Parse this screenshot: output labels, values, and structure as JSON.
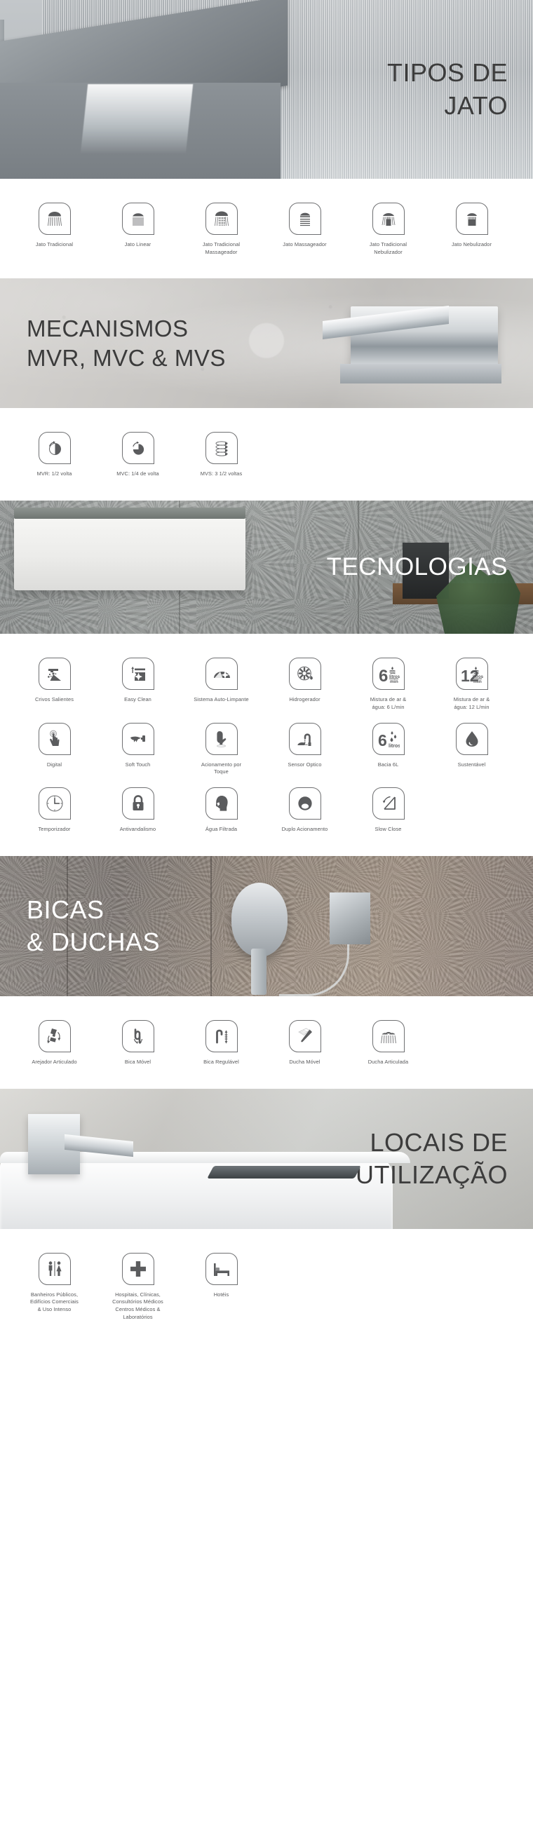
{
  "sections": [
    {
      "id": "tipos-de-jato",
      "hero": {
        "title": "TIPOS DE\nJATO",
        "align": "right",
        "text_color": "#3c3c3c"
      },
      "items": [
        {
          "icon": "jato-tradicional-icon",
          "label": "Jato Tradicional"
        },
        {
          "icon": "jato-linear-icon",
          "label": "Jato Linear"
        },
        {
          "icon": "jato-tradicional-massageador-icon",
          "label": "Jato Tradicional\nMassageador"
        },
        {
          "icon": "jato-massageador-icon",
          "label": "Jato Massageador"
        },
        {
          "icon": "jato-tradicional-nebulizador-icon",
          "label": "Jato Tradicional\nNebulizador"
        },
        {
          "icon": "jato-nebulizador-icon",
          "label": "Jato Nebulizador"
        }
      ]
    },
    {
      "id": "mecanismos",
      "hero": {
        "title": "MECANISMOS\nMVR, MVC & MVS",
        "align": "left",
        "text_color": "#3b3b3b"
      },
      "items": [
        {
          "icon": "meia-volta-icon",
          "label": "MVR: 1/2 volta"
        },
        {
          "icon": "quarto-de-volta-icon",
          "label": "MVC: 1/4 de volta"
        },
        {
          "icon": "tres-voltas-e-meia-icon",
          "label": "MVS: 3 1/2 voltas"
        }
      ]
    },
    {
      "id": "tecnologias",
      "hero": {
        "title": "TECNOLOGIAS",
        "align": "right",
        "text_color": "#ffffff"
      },
      "items": [
        {
          "icon": "crivos-salientes-icon",
          "label": "Crivos Salientes"
        },
        {
          "icon": "easy-clean-icon",
          "label": "Easy Clean"
        },
        {
          "icon": "sistema-auto-limpante-icon",
          "label": "Sistema Auto-Limpante"
        },
        {
          "icon": "hidrogerador-icon",
          "label": "Hidrogerador"
        },
        {
          "icon": "mistura-ar-agua-6-icon",
          "label": "Mistura de ar &\nágua: 6 L/min"
        },
        {
          "icon": "mistura-ar-agua-12-icon",
          "label": "Mistura de ar &\nágua: 12 L/min"
        },
        {
          "icon": "digital-icon",
          "label": "Digital"
        },
        {
          "icon": "soft-touch-icon",
          "label": "Soft Touch"
        },
        {
          "icon": "acionamento-por-toque-icon",
          "label": "Acionamento por\nToque"
        },
        {
          "icon": "sensor-optico-icon",
          "label": "Sensor Optico"
        },
        {
          "icon": "bacia-6l-icon",
          "label": "Bacia 6L"
        },
        {
          "icon": "sustentavel-icon",
          "label": "Sustentável"
        },
        {
          "icon": "temporizador-icon",
          "label": "Temporizador"
        },
        {
          "icon": "antivandalismo-icon",
          "label": "Antivandalismo"
        },
        {
          "icon": "agua-filtrada-icon",
          "label": "Água Filtrada"
        },
        {
          "icon": "duplo-acionamento-icon",
          "label": "Duplo Acionamento"
        },
        {
          "icon": "slow-close-icon",
          "label": "Slow Close"
        }
      ]
    },
    {
      "id": "bicas-e-duchas",
      "hero": {
        "title": "BICAS\n& DUCHAS",
        "align": "left",
        "text_color": "#ffffff"
      },
      "items": [
        {
          "icon": "arejador-articulado-icon",
          "label": "Arejador Articulado"
        },
        {
          "icon": "bica-movel-icon",
          "label": "Bica Móvel"
        },
        {
          "icon": "bica-regulavel-icon",
          "label": "Bica Regulável"
        },
        {
          "icon": "ducha-movel-icon",
          "label": "Ducha Móvel"
        },
        {
          "icon": "ducha-articulada-icon",
          "label": "Ducha Articulada"
        }
      ]
    },
    {
      "id": "locais-de-utilizacao",
      "hero": {
        "title": "LOCAIS DE\nUTILIZAÇÃO",
        "align": "right",
        "text_color": "#3c3c3c"
      },
      "items": [
        {
          "icon": "banheiros-publicos-icon",
          "label": "Banheiros Públicos,\nEdifícios Comerciais\n& Uso Intenso"
        },
        {
          "icon": "hospitais-clinicas-icon",
          "label": "Hospitais, Clínicas,\nConsultórios Médicos\nCentros Médicos &\nLaboratórios"
        },
        {
          "icon": "hoteis-icon",
          "label": "Hotéis"
        }
      ]
    }
  ],
  "colors": {
    "icon_stroke": "#6f7072",
    "icon_fill": "#5b5c5e",
    "label_text": "#58595b",
    "dark_title": "#3c3c3c",
    "light_title": "#ffffff"
  }
}
